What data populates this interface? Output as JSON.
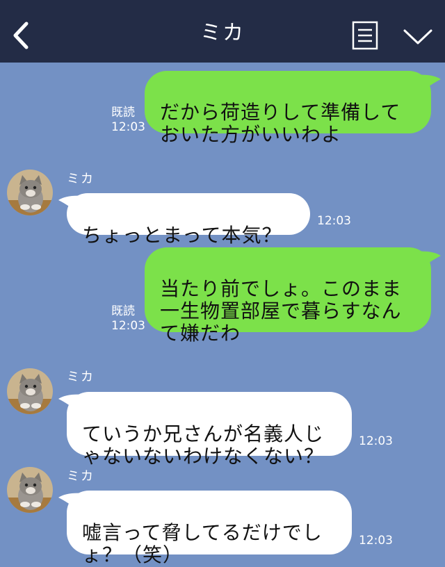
{
  "header": {
    "title": "ミカ",
    "back_icon": "chevron-left-icon",
    "menu_icon": "menu-list-icon",
    "collapse_icon": "chevron-down-icon",
    "background": "#232c46"
  },
  "chat": {
    "background": "#7391c4",
    "outgoing_color": "#7ce14a",
    "incoming_color": "#ffffff",
    "messages": [
      {
        "direction": "outgoing",
        "text": "だから荷造りして準備して\nおいた方がいいわよ",
        "read_label": "既読",
        "time": "12:03"
      },
      {
        "direction": "incoming",
        "sender": "ミカ",
        "text": "ちょっとまって本気？",
        "time": "12:03"
      },
      {
        "direction": "outgoing",
        "text": "当たり前でしょ。このまま\n一生物置部屋で暮らすなん\nて嫌だわ",
        "read_label": "既読",
        "time": "12:03"
      },
      {
        "direction": "incoming",
        "sender": "ミカ",
        "text": "ていうか兄さんが名義人じ\nゃないないわけなくない？",
        "time": "12:03"
      },
      {
        "direction": "incoming",
        "sender": "ミカ",
        "text": "嘘言って脅してるだけでし\nょ？（笑）",
        "time": "12:03"
      }
    ]
  }
}
